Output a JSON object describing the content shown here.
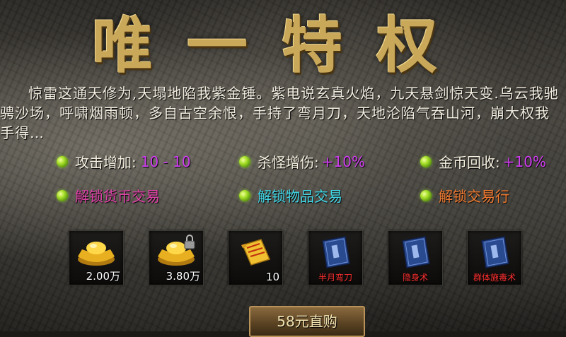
{
  "title": "唯一特权",
  "description": "惊雷这通天修为,天塌地陷我紫金锤。紫电说玄真火焰，九天悬剑惊天变.乌云我驰骋沙场，呼啸烟雨顿，多自古空余恨，手持了弯月刀，天地沦陷气吞山河，崩大权我手得…",
  "attributes": [
    {
      "label": "攻击增加:",
      "value": "10 - 10"
    },
    {
      "label": "杀怪增伤:",
      "value": "+10%"
    },
    {
      "label": "金币回收:",
      "value": "+10%"
    }
  ],
  "unlocks": [
    {
      "label": "解锁货币交易",
      "color": "#e040a8"
    },
    {
      "label": "解锁物品交易",
      "color": "#40d8e8"
    },
    {
      "label": "解锁交易行",
      "color": "#f07a30"
    }
  ],
  "items": [
    {
      "icon": "gold-ingot-icon",
      "count": "2.00万",
      "name": ""
    },
    {
      "icon": "locked-gold-ingot-icon",
      "count": "3.80万",
      "name": ""
    },
    {
      "icon": "scroll-icon",
      "count": "10",
      "name": ""
    },
    {
      "icon": "skill-book-icon",
      "count": "",
      "name": "半月弯刀"
    },
    {
      "icon": "skill-book-icon",
      "count": "",
      "name": "隐身术"
    },
    {
      "icon": "skill-book-icon",
      "count": "",
      "name": "群体施毒术"
    }
  ],
  "buy_button": {
    "label": "58元直购"
  }
}
